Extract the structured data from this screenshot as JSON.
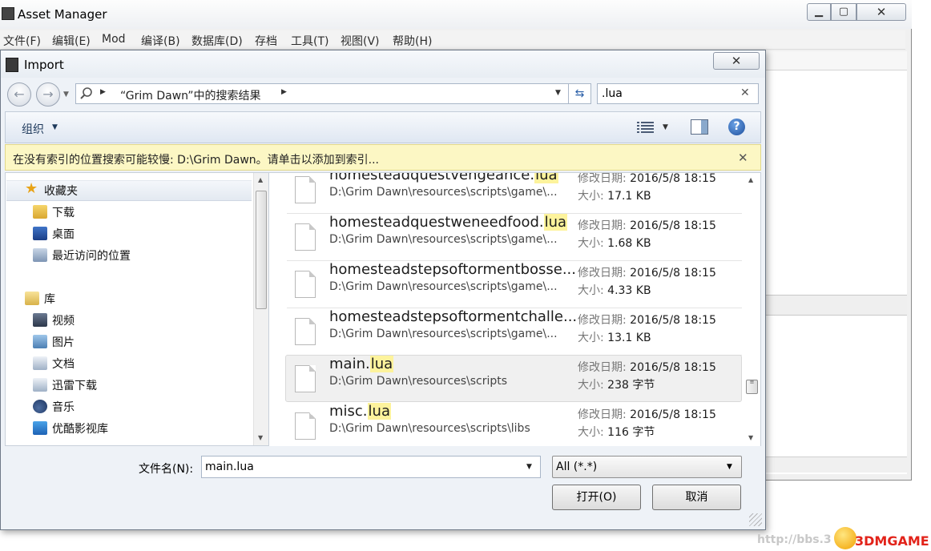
{
  "asset_manager": {
    "title": "Asset Manager",
    "window_controls": {
      "minimize": "▁",
      "maximize": "▢",
      "close": "✕"
    },
    "menu": [
      "文件(F)",
      "编辑(E)",
      "Mod",
      "编译(B)",
      "数据库(D)",
      "存档",
      "工具(T)",
      "视图(V)",
      "帮助(H)"
    ]
  },
  "import_dialog": {
    "title": "Import",
    "close_glyph": "✕",
    "address_path": "“Grim Dawn”中的搜索结果",
    "search_value": ".lua",
    "toolbar": {
      "organize_label": "组织"
    },
    "info_bar_text": "在没有索引的位置搜索可能较慢: D:\\Grim Dawn。请单击以添加到索引...",
    "nav": {
      "favorites": "收藏夹",
      "downloads": "下载",
      "desktop": "桌面",
      "recent": "最近访问的位置",
      "libraries": "库",
      "videos": "视频",
      "pictures": "图片",
      "documents": "文档",
      "xunlei": "迅雷下载",
      "music": "音乐",
      "youku": "优酷影视库"
    },
    "files": [
      {
        "name_prefix": "homesteadquestvengeance.",
        "name_match": "lua",
        "path": "D:\\Grim Dawn\\resources\\scripts\\game\\...",
        "date_label": "修改日期: ",
        "date": "2016/5/8 18:15",
        "size_label": "大小: ",
        "size": "17.1 KB"
      },
      {
        "name_prefix": "homesteadquestweneedfood.",
        "name_match": "lua",
        "path": "D:\\Grim Dawn\\resources\\scripts\\game\\...",
        "date_label": "修改日期: ",
        "date": "2016/5/8 18:15",
        "size_label": "大小: ",
        "size": "1.68 KB"
      },
      {
        "name_prefix": "homesteadstepsoftormentbosse...",
        "name_match": "",
        "path": "D:\\Grim Dawn\\resources\\scripts\\game\\...",
        "date_label": "修改日期: ",
        "date": "2016/5/8 18:15",
        "size_label": "大小: ",
        "size": "4.33 KB"
      },
      {
        "name_prefix": "homesteadstepsoftormentchalle...",
        "name_match": "",
        "path": "D:\\Grim Dawn\\resources\\scripts\\game\\...",
        "date_label": "修改日期: ",
        "date": "2016/5/8 18:15",
        "size_label": "大小: ",
        "size": "13.1 KB"
      },
      {
        "name_prefix": "main.",
        "name_match": "lua",
        "path": "D:\\Grim Dawn\\resources\\scripts",
        "date_label": "修改日期: ",
        "date": "2016/5/8 18:15",
        "size_label": "大小: ",
        "size": "238 字节"
      },
      {
        "name_prefix": "misc.",
        "name_match": "lua",
        "path": "D:\\Grim Dawn\\resources\\scripts\\libs",
        "date_label": "修改日期: ",
        "date": "2016/5/8 18:15",
        "size_label": "大小: ",
        "size": "116 字节"
      }
    ],
    "filename_label": "文件名(N):",
    "filename_value": "main.lua",
    "filetype_value": "All (*.*)",
    "open_label": "打开(O)",
    "cancel_label": "取消"
  },
  "watermark": {
    "url": "http://bbs.3",
    "brand": "3DMGAME"
  }
}
